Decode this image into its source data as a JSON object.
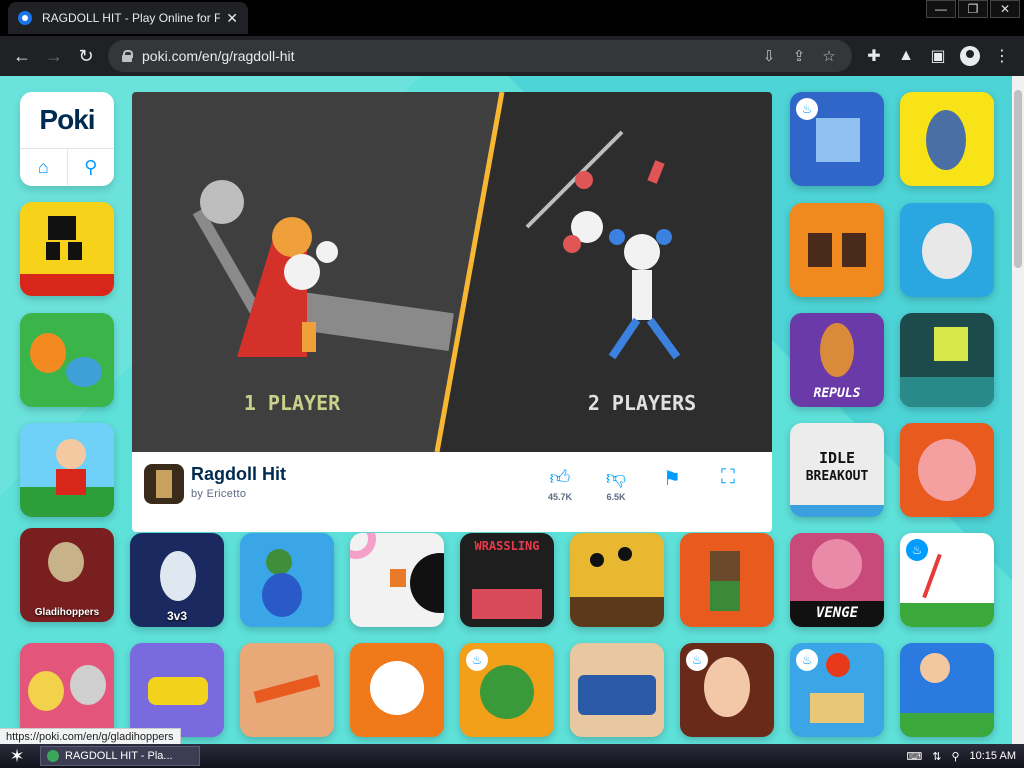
{
  "browser": {
    "tab_title": "RAGDOLL HIT - Play Online for Free",
    "tab_close": "✕",
    "url": "poki.com/en/g/ragdoll-hit",
    "win_minimize": "—",
    "win_restore": "❐",
    "win_close": "✕",
    "status_url": "https://poki.com/en/g/gladihoppers"
  },
  "sidebar": {
    "logo": "Poki",
    "home_icon": "home-icon",
    "search_icon": "search-icon"
  },
  "hero": {
    "left_label": "1 PLAYER",
    "right_label": "2 PLAYERS",
    "title": "Ragdoll Hit",
    "author": "by Ericetto",
    "likes": "45.7K",
    "dislikes": "6.5K"
  },
  "tiles": {
    "gladihoppers": "Gladihoppers",
    "three_v_three": "3v3",
    "wrassling": "WRASSLING",
    "venge": "VENGE",
    "repuls": "REPULS",
    "idle_breakout_line1": "IDLE",
    "idle_breakout_line2": "BREAKOUT"
  },
  "taskbar": {
    "task_label": "RAGDOLL HIT - Pla...",
    "time": "10:15 AM"
  },
  "colors": {
    "page_bg": "#5ee1d9",
    "poki_blue": "#009cff",
    "poki_navy": "#002b50"
  }
}
